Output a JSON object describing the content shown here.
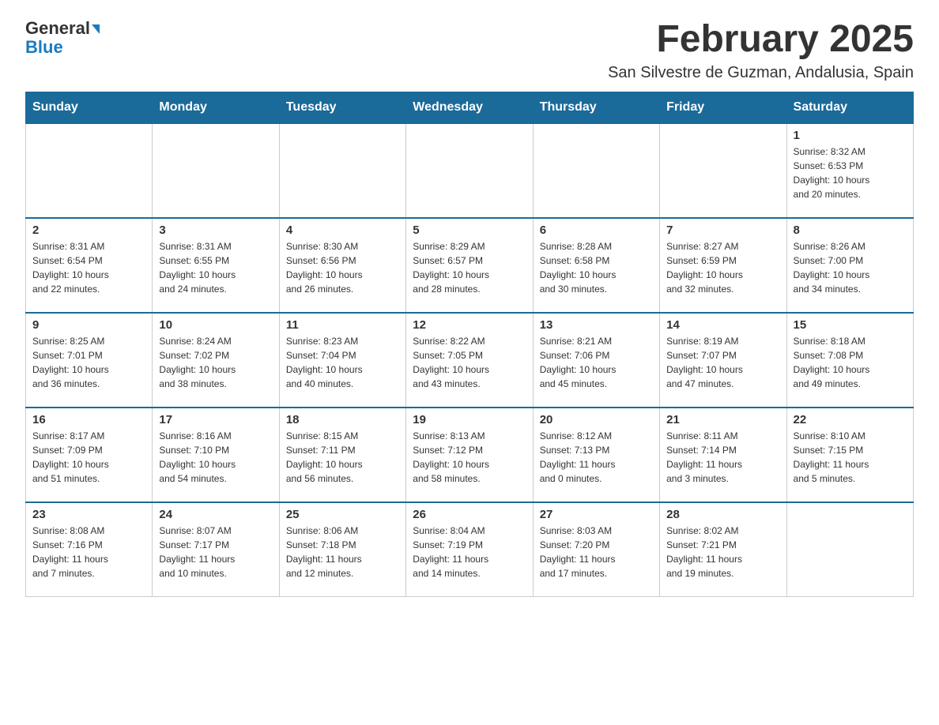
{
  "header": {
    "logo_line1": "General",
    "logo_line2": "Blue",
    "title": "February 2025",
    "subtitle": "San Silvestre de Guzman, Andalusia, Spain"
  },
  "days_of_week": [
    "Sunday",
    "Monday",
    "Tuesday",
    "Wednesday",
    "Thursday",
    "Friday",
    "Saturday"
  ],
  "weeks": [
    [
      {
        "day": "",
        "info": ""
      },
      {
        "day": "",
        "info": ""
      },
      {
        "day": "",
        "info": ""
      },
      {
        "day": "",
        "info": ""
      },
      {
        "day": "",
        "info": ""
      },
      {
        "day": "",
        "info": ""
      },
      {
        "day": "1",
        "info": "Sunrise: 8:32 AM\nSunset: 6:53 PM\nDaylight: 10 hours\nand 20 minutes."
      }
    ],
    [
      {
        "day": "2",
        "info": "Sunrise: 8:31 AM\nSunset: 6:54 PM\nDaylight: 10 hours\nand 22 minutes."
      },
      {
        "day": "3",
        "info": "Sunrise: 8:31 AM\nSunset: 6:55 PM\nDaylight: 10 hours\nand 24 minutes."
      },
      {
        "day": "4",
        "info": "Sunrise: 8:30 AM\nSunset: 6:56 PM\nDaylight: 10 hours\nand 26 minutes."
      },
      {
        "day": "5",
        "info": "Sunrise: 8:29 AM\nSunset: 6:57 PM\nDaylight: 10 hours\nand 28 minutes."
      },
      {
        "day": "6",
        "info": "Sunrise: 8:28 AM\nSunset: 6:58 PM\nDaylight: 10 hours\nand 30 minutes."
      },
      {
        "day": "7",
        "info": "Sunrise: 8:27 AM\nSunset: 6:59 PM\nDaylight: 10 hours\nand 32 minutes."
      },
      {
        "day": "8",
        "info": "Sunrise: 8:26 AM\nSunset: 7:00 PM\nDaylight: 10 hours\nand 34 minutes."
      }
    ],
    [
      {
        "day": "9",
        "info": "Sunrise: 8:25 AM\nSunset: 7:01 PM\nDaylight: 10 hours\nand 36 minutes."
      },
      {
        "day": "10",
        "info": "Sunrise: 8:24 AM\nSunset: 7:02 PM\nDaylight: 10 hours\nand 38 minutes."
      },
      {
        "day": "11",
        "info": "Sunrise: 8:23 AM\nSunset: 7:04 PM\nDaylight: 10 hours\nand 40 minutes."
      },
      {
        "day": "12",
        "info": "Sunrise: 8:22 AM\nSunset: 7:05 PM\nDaylight: 10 hours\nand 43 minutes."
      },
      {
        "day": "13",
        "info": "Sunrise: 8:21 AM\nSunset: 7:06 PM\nDaylight: 10 hours\nand 45 minutes."
      },
      {
        "day": "14",
        "info": "Sunrise: 8:19 AM\nSunset: 7:07 PM\nDaylight: 10 hours\nand 47 minutes."
      },
      {
        "day": "15",
        "info": "Sunrise: 8:18 AM\nSunset: 7:08 PM\nDaylight: 10 hours\nand 49 minutes."
      }
    ],
    [
      {
        "day": "16",
        "info": "Sunrise: 8:17 AM\nSunset: 7:09 PM\nDaylight: 10 hours\nand 51 minutes."
      },
      {
        "day": "17",
        "info": "Sunrise: 8:16 AM\nSunset: 7:10 PM\nDaylight: 10 hours\nand 54 minutes."
      },
      {
        "day": "18",
        "info": "Sunrise: 8:15 AM\nSunset: 7:11 PM\nDaylight: 10 hours\nand 56 minutes."
      },
      {
        "day": "19",
        "info": "Sunrise: 8:13 AM\nSunset: 7:12 PM\nDaylight: 10 hours\nand 58 minutes."
      },
      {
        "day": "20",
        "info": "Sunrise: 8:12 AM\nSunset: 7:13 PM\nDaylight: 11 hours\nand 0 minutes."
      },
      {
        "day": "21",
        "info": "Sunrise: 8:11 AM\nSunset: 7:14 PM\nDaylight: 11 hours\nand 3 minutes."
      },
      {
        "day": "22",
        "info": "Sunrise: 8:10 AM\nSunset: 7:15 PM\nDaylight: 11 hours\nand 5 minutes."
      }
    ],
    [
      {
        "day": "23",
        "info": "Sunrise: 8:08 AM\nSunset: 7:16 PM\nDaylight: 11 hours\nand 7 minutes."
      },
      {
        "day": "24",
        "info": "Sunrise: 8:07 AM\nSunset: 7:17 PM\nDaylight: 11 hours\nand 10 minutes."
      },
      {
        "day": "25",
        "info": "Sunrise: 8:06 AM\nSunset: 7:18 PM\nDaylight: 11 hours\nand 12 minutes."
      },
      {
        "day": "26",
        "info": "Sunrise: 8:04 AM\nSunset: 7:19 PM\nDaylight: 11 hours\nand 14 minutes."
      },
      {
        "day": "27",
        "info": "Sunrise: 8:03 AM\nSunset: 7:20 PM\nDaylight: 11 hours\nand 17 minutes."
      },
      {
        "day": "28",
        "info": "Sunrise: 8:02 AM\nSunset: 7:21 PM\nDaylight: 11 hours\nand 19 minutes."
      },
      {
        "day": "",
        "info": ""
      }
    ]
  ]
}
